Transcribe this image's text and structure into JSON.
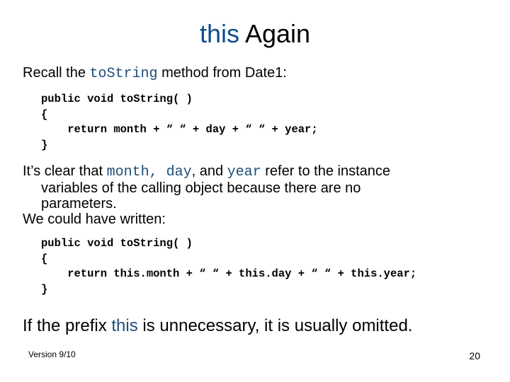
{
  "title": {
    "keyword": "this",
    "rest": " Again"
  },
  "intro": {
    "before": "Recall the ",
    "code": "toString",
    "after": " method from Date1:"
  },
  "code1": [
    "public void toString( )",
    "{",
    "    return month + “ “ + day + “ “ + year;",
    "}"
  ],
  "para2": {
    "p1": "It’s clear that ",
    "c1": "month, day",
    "p2": ", and ",
    "c2": "year",
    "p3": " refer to the instance",
    "line2": "variables of the calling object because there are no",
    "line3": "parameters.",
    "line4": "We could have written:"
  },
  "code2": [
    "public void toString( )",
    "{",
    "    return this.month + “ “ + this.day + “ “ + this.year;",
    "}"
  ],
  "conclusion": {
    "before": "If the prefix ",
    "keyword": "this",
    "after": " is unnecessary, it is usually omitted."
  },
  "footer": {
    "version": "Version 9/10",
    "page": "20"
  }
}
